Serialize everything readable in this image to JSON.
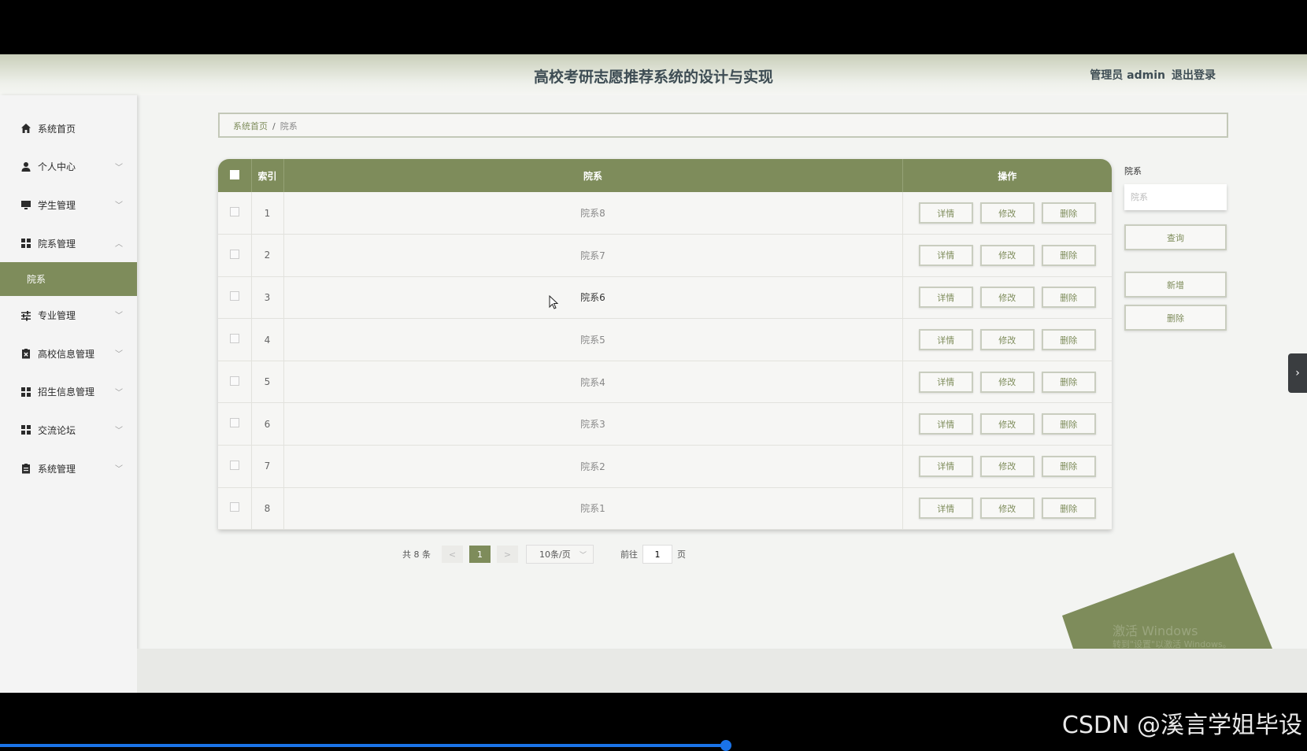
{
  "header": {
    "title": "高校考研志愿推荐系统的设计与实现",
    "user_label": "管理员 admin",
    "logout_label": "退出登录"
  },
  "sidebar": {
    "items": [
      {
        "label": "系统首页",
        "icon": "home-icon"
      },
      {
        "label": "个人中心",
        "icon": "user-icon",
        "chev": "﹀"
      },
      {
        "label": "学生管理",
        "icon": "monitor-icon",
        "chev": "﹀"
      },
      {
        "label": "院系管理",
        "icon": "grid-icon",
        "chev": "︿"
      },
      {
        "label": "专业管理",
        "icon": "sliders-icon",
        "chev": "﹀"
      },
      {
        "label": "高校信息管理",
        "icon": "clipboard-x-icon",
        "chev": "﹀"
      },
      {
        "label": "招生信息管理",
        "icon": "grid-icon",
        "chev": "﹀"
      },
      {
        "label": "交流论坛",
        "icon": "grid-icon",
        "chev": "﹀"
      },
      {
        "label": "系统管理",
        "icon": "clipboard-icon",
        "chev": "﹀"
      }
    ],
    "sub_item": "院系"
  },
  "breadcrumb": {
    "home": "系统首页",
    "sep": "/",
    "current": "院系"
  },
  "table": {
    "headers": {
      "index": "索引",
      "dept": "院系",
      "ops": "操作"
    },
    "rows": [
      {
        "index": "1",
        "dept": "院系8"
      },
      {
        "index": "2",
        "dept": "院系7"
      },
      {
        "index": "3",
        "dept": "院系6"
      },
      {
        "index": "4",
        "dept": "院系5"
      },
      {
        "index": "5",
        "dept": "院系4"
      },
      {
        "index": "6",
        "dept": "院系3"
      },
      {
        "index": "7",
        "dept": "院系2"
      },
      {
        "index": "8",
        "dept": "院系1"
      }
    ],
    "op_labels": {
      "detail": "详情",
      "edit": "修改",
      "delete": "删除"
    }
  },
  "search": {
    "label": "院系",
    "placeholder": "院系",
    "query_label": "查询",
    "add_label": "新增",
    "delete_label": "删除"
  },
  "pager": {
    "total": "共 8 条",
    "prev": "<",
    "next": ">",
    "current_page": "1",
    "page_size": "10条/页",
    "goto_prefix": "前往",
    "goto_value": "1",
    "goto_suffix": "页"
  },
  "overlay": {
    "activate_title": "激活 Windows",
    "activate_sub": "转到\"设置\"以激活 Windows。",
    "toggle": "›",
    "watermark": "CSDN @溪言学姐毕设"
  },
  "colors": {
    "accent": "#7e8c5b"
  }
}
